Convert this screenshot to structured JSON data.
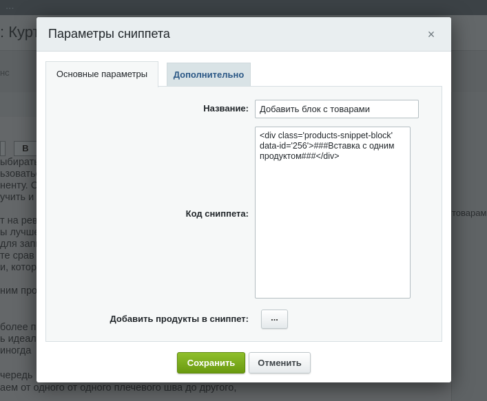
{
  "background": {
    "top_text": "...",
    "title": ": Курт",
    "tab_fragment": "нс",
    "toolbar_bold": "B",
    "lines": [
      "ыбирать",
      "ьзоватьс",
      "ненту. С",
      "учить и",
      "т на рев",
      "ы лучше",
      "для запи",
      "те срав",
      "и, котор",
      "ним про",
      "более п",
      "ь идеал",
      " иногда",
      "чередь",
      "аем от одного от одного плечевого шва до другого,"
    ],
    "right_fragment": "товарам"
  },
  "dialog": {
    "title": "Параметры сниппета",
    "close_glyph": "×",
    "tabs": [
      {
        "label": "Основные параметры",
        "active": true
      },
      {
        "label": "Дополнительно",
        "active": false
      }
    ],
    "fields": {
      "name_label": "Название:",
      "name_value": "Добавить блок с товарами",
      "code_label": "Код сниппета:",
      "code_value": "<div class='products-snippet-block' data-id='256'>###Вставка с одним продуктом###</div>",
      "add_products_label": "Добавить продукты в сниппет:",
      "add_products_button": "..."
    },
    "buttons": {
      "save": "Сохранить",
      "cancel": "Отменить"
    },
    "colors": {
      "save_button": "#7aaa1c",
      "tab_link": "#2a5785",
      "header_bg": "#e9eef0"
    }
  }
}
